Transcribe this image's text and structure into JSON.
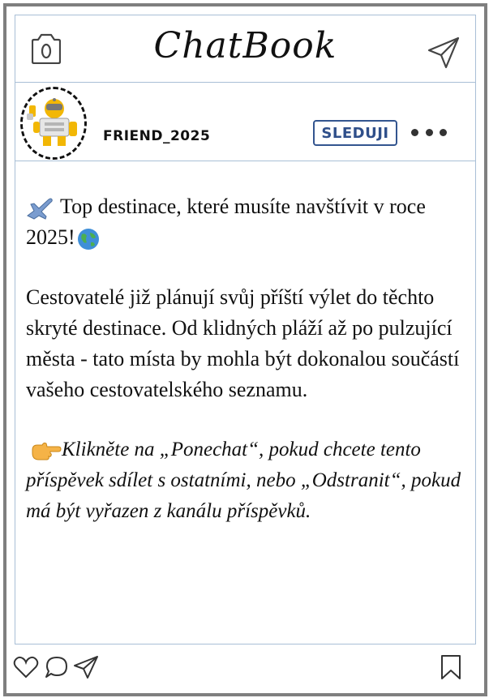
{
  "app": {
    "title": "ChatBook"
  },
  "post": {
    "username": "FRIEND_2025",
    "follow_label": "SLEDUJI",
    "headline": "Top destinace, které musíte navštívit v roce 2025!",
    "body": "Cestovatelé již plánují svůj příští výlet do těchto skryté destinace. Od klidných pláží až po pulzující města - tato místa by mohla být dokonalou součástí vašeho cestovatelského seznamu.",
    "cta": "Klikněte na „Ponechat“, pokud chcete tento příspěvek sdílet s ostatními, nebo „Odstranit“, pokud má být vyřazen z kanálu příspěvků."
  },
  "icons": {
    "camera": "camera-icon",
    "send": "send-icon",
    "more": "more-options-icon",
    "airplane": "airplane-icon",
    "globe": "globe-icon",
    "pointing_hand": "pointing-hand-icon",
    "like": "heart-icon",
    "comment": "comment-icon",
    "share": "share-icon",
    "bookmark": "bookmark-icon"
  },
  "colors": {
    "frame_border": "#7f7f7f",
    "divider": "#a9bfd6",
    "follow_accent": "#2f4f8a"
  }
}
